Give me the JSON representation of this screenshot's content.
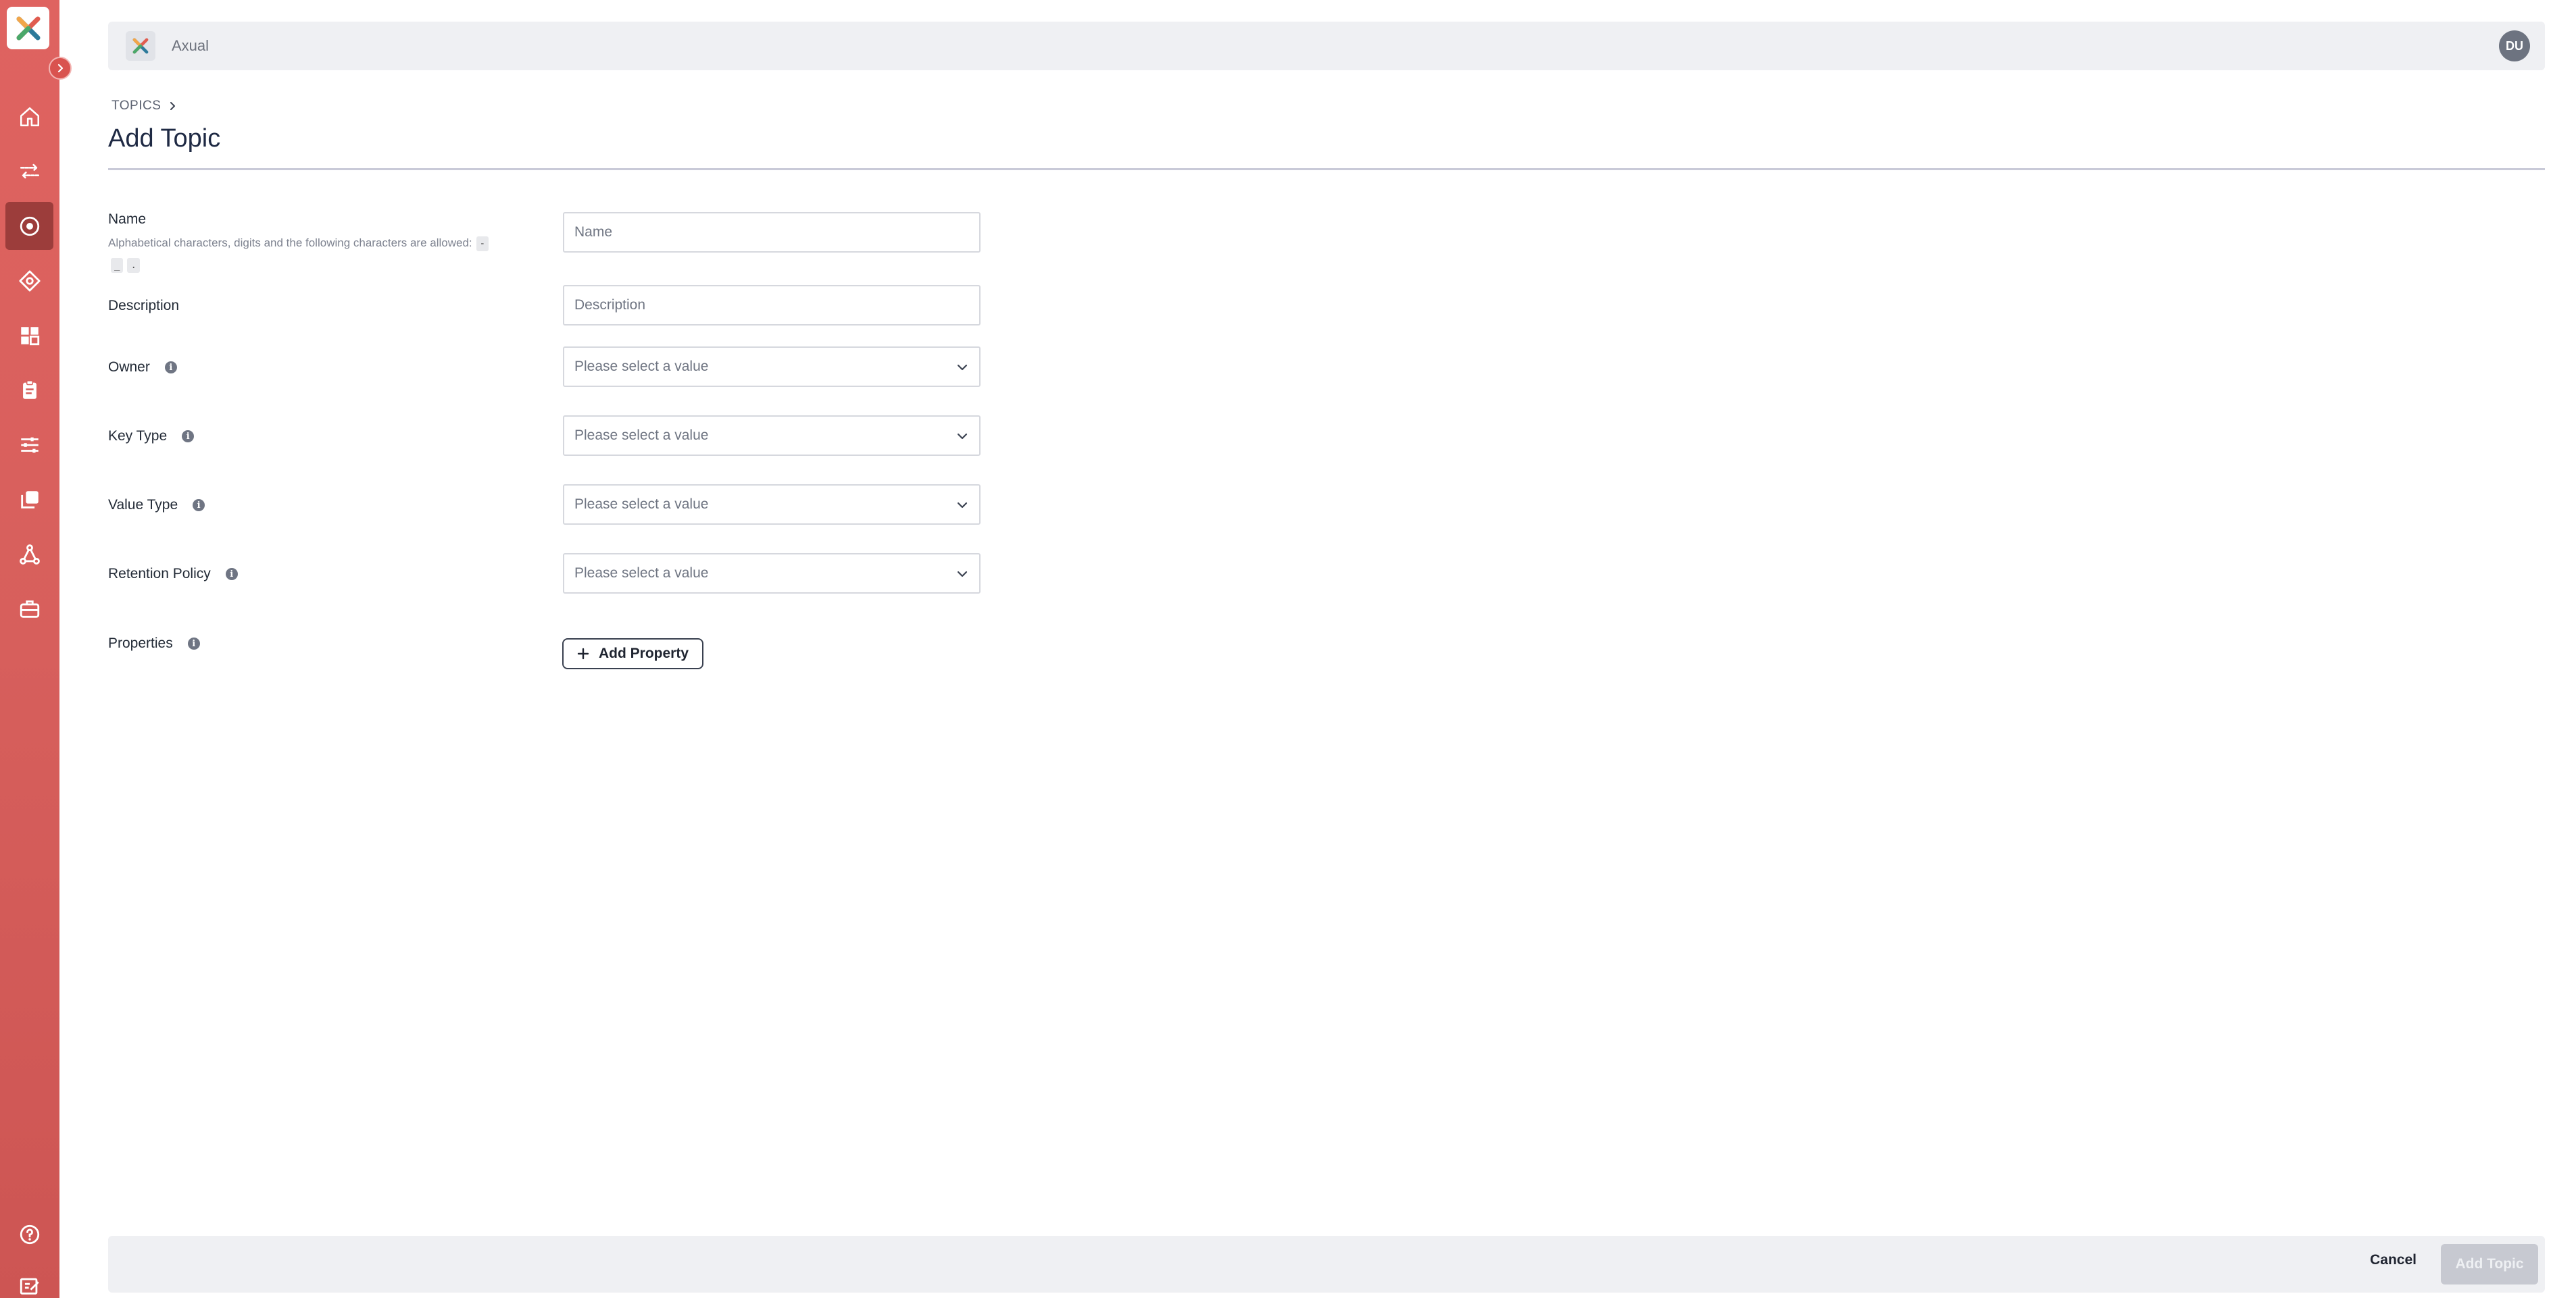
{
  "app": {
    "name": "Axual",
    "user_initials": "DU",
    "accent_color": "#d75f5c",
    "active_nav_color": "#9c3d3b"
  },
  "sidebar": {
    "items": [
      {
        "icon": "home-icon",
        "label": "Home",
        "active": false
      },
      {
        "icon": "streams-icon",
        "label": "Streams",
        "active": false
      },
      {
        "icon": "topics-icon",
        "label": "Topics",
        "active": true
      },
      {
        "icon": "schemas-icon",
        "label": "Schemas",
        "active": false
      },
      {
        "icon": "applications-icon",
        "label": "Applications",
        "active": false
      },
      {
        "icon": "clipboard-icon",
        "label": "Requests",
        "active": false
      },
      {
        "icon": "settings-sliders-icon",
        "label": "Settings",
        "active": false
      },
      {
        "icon": "copy-icon",
        "label": "Environments",
        "active": false
      },
      {
        "icon": "network-icon",
        "label": "Instances",
        "active": false
      },
      {
        "icon": "briefcase-icon",
        "label": "Groups",
        "active": false
      }
    ],
    "bottom_items": [
      {
        "icon": "help-icon",
        "label": "Help"
      },
      {
        "icon": "feedback-icon",
        "label": "Feedback"
      }
    ]
  },
  "breadcrumb": {
    "parent": "TOPICS"
  },
  "page": {
    "title": "Add Topic"
  },
  "form": {
    "name": {
      "label": "Name",
      "placeholder": "Name",
      "hint": "Alphabetical characters, digits and the following characters are allowed:",
      "allowed_chars": [
        "-",
        "_",
        "."
      ]
    },
    "description": {
      "label": "Description",
      "placeholder": "Description"
    },
    "owner": {
      "label": "Owner",
      "value": "Please select a value"
    },
    "key_type": {
      "label": "Key Type",
      "value": "Please select a value"
    },
    "value_type": {
      "label": "Value Type",
      "value": "Please select a value"
    },
    "retention_policy": {
      "label": "Retention Policy",
      "value": "Please select a value"
    },
    "properties": {
      "label": "Properties",
      "add_button": "Add Property"
    }
  },
  "footer": {
    "cancel_label": "Cancel",
    "submit_label": "Add Topic"
  }
}
